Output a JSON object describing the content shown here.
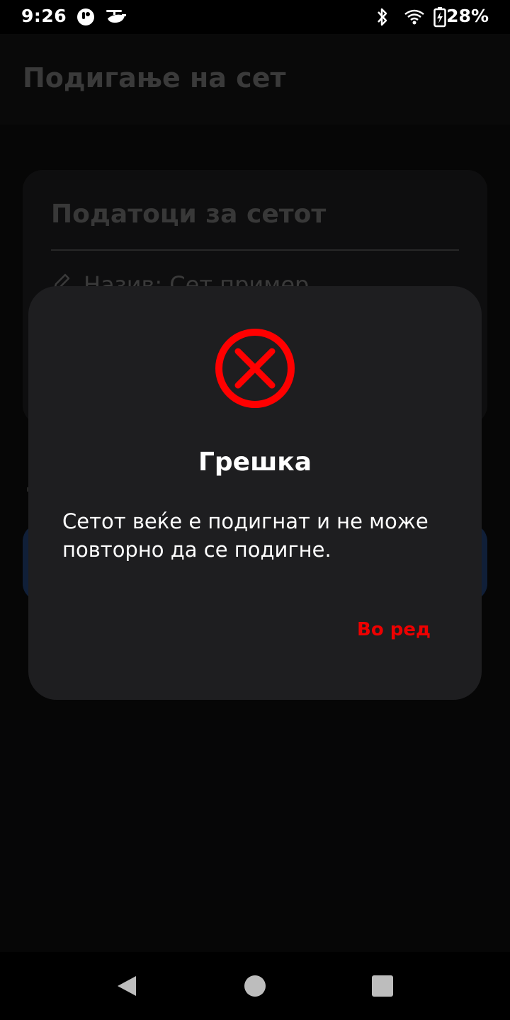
{
  "status_bar": {
    "time": "9:26",
    "battery": "28%",
    "icons": [
      "app-notification-icon",
      "drone-icon",
      "bluetooth-icon",
      "wifi-icon",
      "battery-charging-icon"
    ]
  },
  "app_bar": {
    "title": "Подигање на сет"
  },
  "background_card": {
    "title": "Податоци за сетот",
    "name_row": "Назив: Сет пример"
  },
  "dialog": {
    "icon": "error-x-circle-icon",
    "icon_color": "#ff0000",
    "title": "Грешка",
    "message": "Сетот веќе е подигнат и не може повторно да се подигне.",
    "ok_label": "Во ред",
    "ok_color": "#ee0000"
  },
  "nav_bar": {
    "icons": [
      "back-icon",
      "home-icon",
      "recents-icon"
    ]
  }
}
